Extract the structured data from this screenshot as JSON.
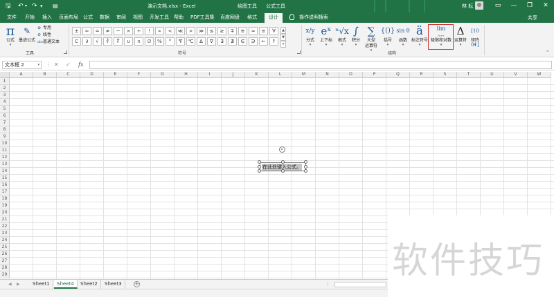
{
  "title_bar": {
    "doc_title": "演示文档.xlsx - Excel",
    "context_tool_1": "绘图工具",
    "context_tool_2": "公式工具",
    "user_name": "林 耘",
    "save_icon": "save-icon",
    "undo_icon": "undo-icon",
    "redo_icon": "redo-icon",
    "minimize": "—",
    "restore": "❐",
    "close": "✕"
  },
  "tabs": [
    {
      "label": "文件"
    },
    {
      "label": "开始"
    },
    {
      "label": "插入"
    },
    {
      "label": "页面布局"
    },
    {
      "label": "公式"
    },
    {
      "label": "数据"
    },
    {
      "label": "审阅"
    },
    {
      "label": "视图"
    },
    {
      "label": "开发工具"
    },
    {
      "label": "帮助"
    },
    {
      "label": "PDF工具集"
    },
    {
      "label": "百度网盘"
    },
    {
      "label": "格式"
    },
    {
      "label": "设计"
    }
  ],
  "tell_me": "操作说明搜索",
  "share": "共享",
  "ribbon": {
    "tools_group": {
      "label": "工具",
      "equation": {
        "icon": "π",
        "label": "公式"
      },
      "ink": {
        "label": "墨迹公式"
      },
      "professional": "专用",
      "linear": "线性",
      "normal_text": "普通文本"
    },
    "symbols_group": {
      "label": "符号",
      "row1": [
        "±",
        "∞",
        "=",
        "≠",
        "~",
        "×",
        "÷",
        "!",
        "∝",
        "<",
        "≪",
        ">",
        "≫",
        "≤",
        "≥",
        "∓",
        "≅",
        "≈",
        "≡",
        "∀"
      ],
      "row2": [
        "∁",
        "∂",
        "√",
        "∛",
        "∜",
        "∪",
        "∩",
        "∅",
        "%",
        "°",
        "℉",
        "℃",
        "∆",
        "∇",
        "∃",
        "∄",
        "∈",
        "∋",
        "←",
        "↑"
      ]
    },
    "structures_group": {
      "label": "结构",
      "items": [
        {
          "icon": "x/y",
          "label": "分式"
        },
        {
          "icon": "eˣ",
          "label": "上下标"
        },
        {
          "icon": "ⁿ√x",
          "label": "根式"
        },
        {
          "icon": "∫",
          "label": "积分"
        },
        {
          "icon": "∑",
          "label": "大型",
          "label2": "运算符"
        },
        {
          "icon": "{()}",
          "label": "括号"
        },
        {
          "icon": "sin θ",
          "label": "函数"
        },
        {
          "icon": "ä",
          "label": "标注符号"
        },
        {
          "icon": "lim",
          "label": "极限和对数"
        },
        {
          "icon": "Δ",
          "label": "运算符"
        },
        {
          "icon": "[10 01]",
          "label": "矩阵"
        }
      ]
    }
  },
  "formula_bar": {
    "name_box": "文本框 2",
    "cancel": "✕",
    "enter": "✓",
    "fx": "fx",
    "value": ""
  },
  "columns": [
    "A",
    "B",
    "C",
    "D",
    "E",
    "F",
    "G",
    "H",
    "I",
    "J",
    "K",
    "L",
    "M",
    "N",
    "O",
    "P",
    "Q",
    "R",
    "S",
    "T",
    "U",
    "V",
    "W"
  ],
  "rows": [
    "1",
    "2",
    "3",
    "4",
    "5",
    "6",
    "7",
    "8",
    "9",
    "10",
    "11",
    "12",
    "13",
    "14",
    "15",
    "16",
    "17",
    "18",
    "19",
    "20",
    "21",
    "22",
    "23",
    "24",
    "25",
    "26",
    "27",
    "28",
    "29"
  ],
  "equation_box": {
    "text": "在此处键入公式。"
  },
  "sheets": [
    {
      "name": "Sheet1",
      "active": false
    },
    {
      "name": "Sheet4",
      "active": true
    },
    {
      "name": "Sheet2",
      "active": false
    },
    {
      "name": "Sheet3",
      "active": false
    }
  ],
  "watermark": "软件技巧",
  "colors": {
    "excel_green": "#217346",
    "highlight_red": "#d13438",
    "ribbon_bg": "#f3f3f3"
  }
}
